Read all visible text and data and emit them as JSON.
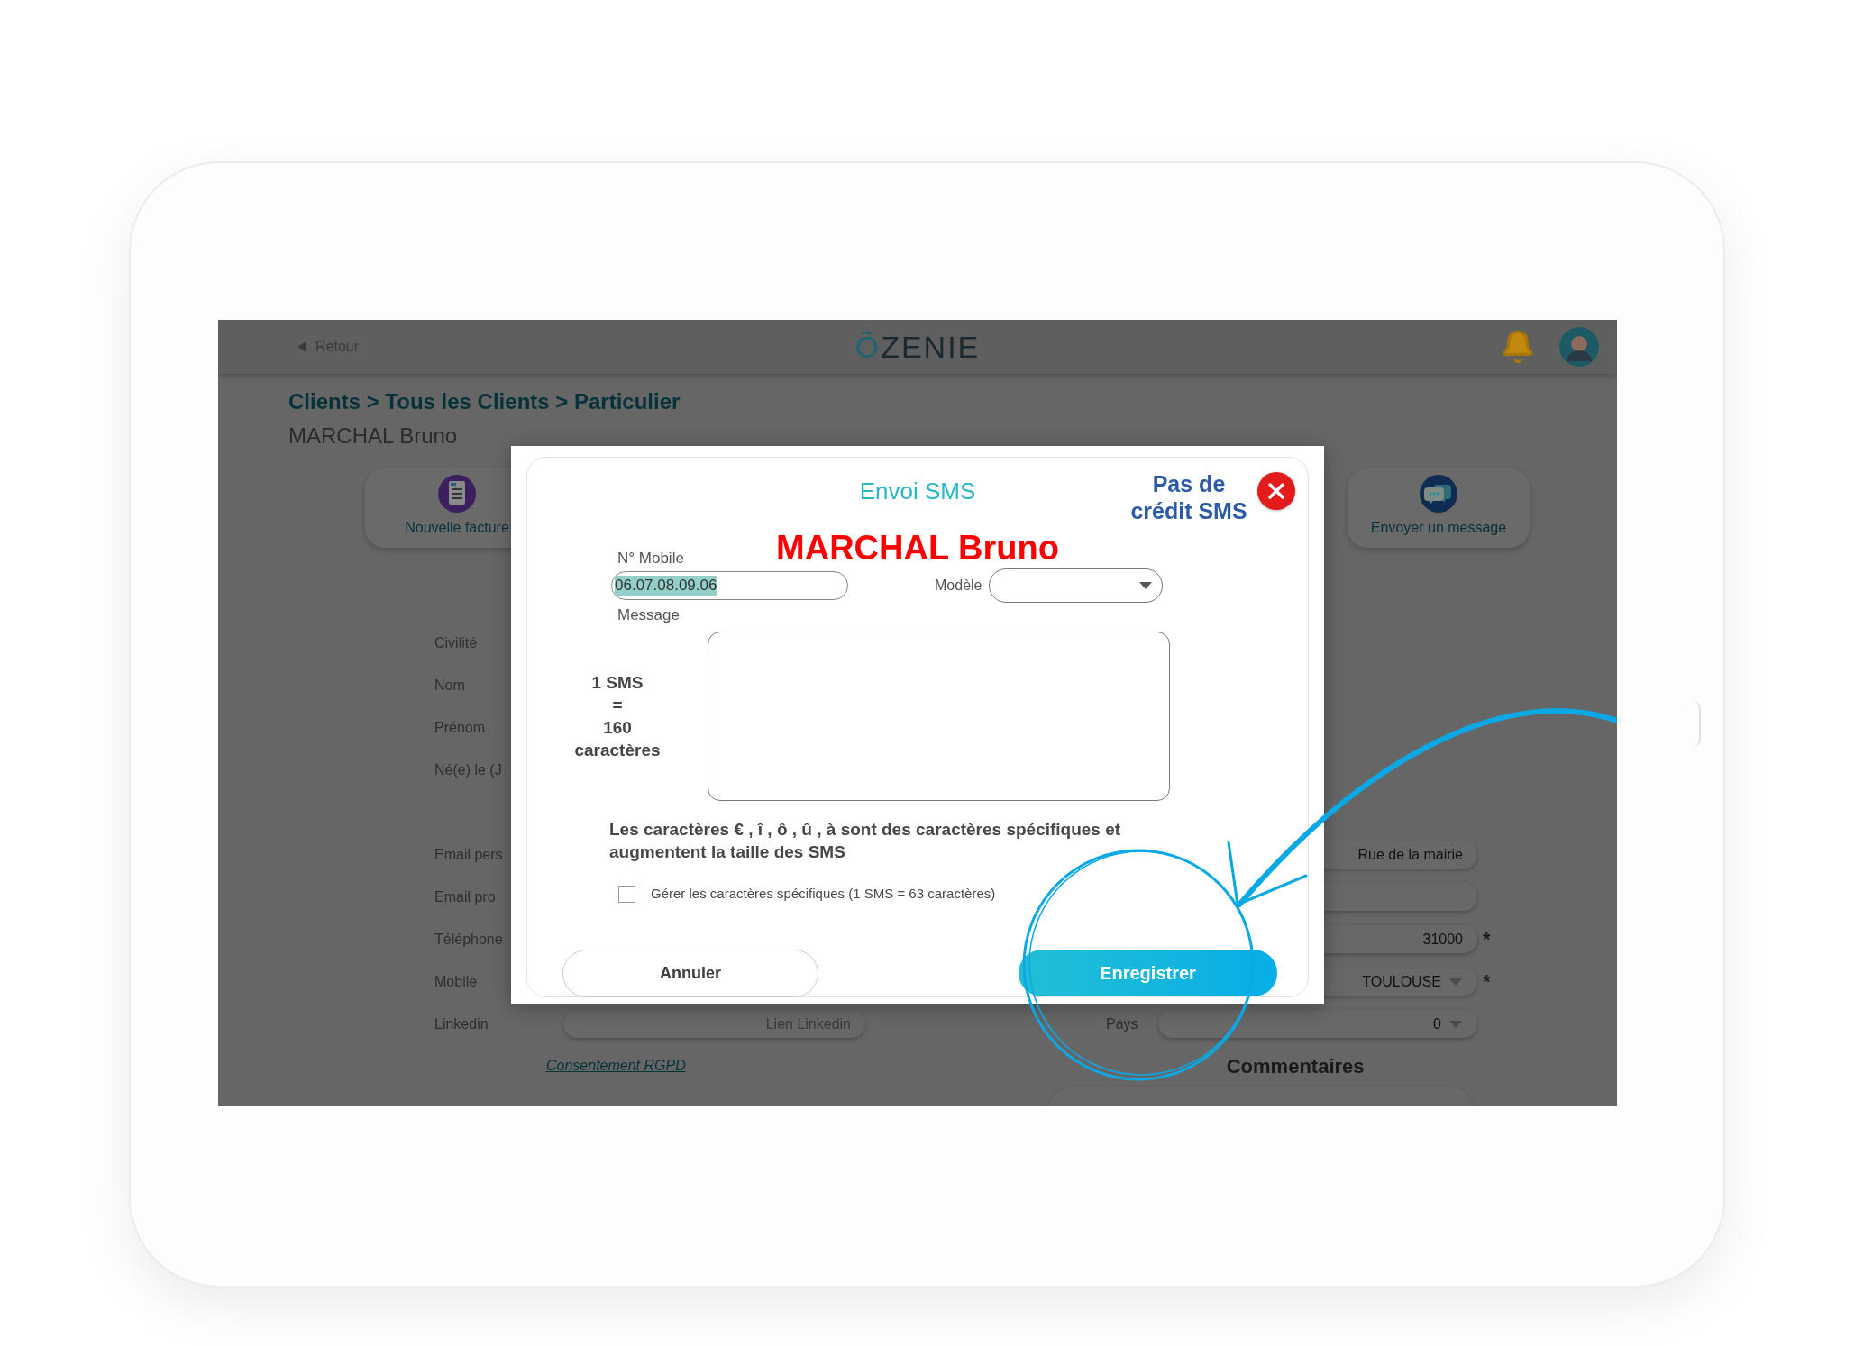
{
  "top_bar": {
    "back_label": "Retour",
    "logo": "ÕZENIE"
  },
  "breadcrumb": "Clients > Tous les Clients > Particulier",
  "client_name": "MARCHAL Bruno",
  "actions": [
    {
      "label": "Nouvelle facture",
      "kind": "invoice"
    },
    {
      "label": "Envoyer un message",
      "kind": "message"
    }
  ],
  "form": {
    "labels": [
      "Civilité",
      "Nom",
      "Prénom",
      "Né(e) le (J",
      "Email pers",
      "Email pro",
      "Téléphone",
      "Mobile",
      "Linkedin"
    ],
    "linkedin": {
      "placeholder": "Lien Linkedin"
    },
    "consent_link": "Consentement RGPD"
  },
  "address_fields": [
    {
      "kind": "text",
      "value": "Rue de la mairie"
    },
    {
      "kind": "text"
    },
    {
      "kind": "text",
      "value": "31000",
      "required_mark": "*"
    },
    {
      "kind": "dropdown",
      "value": "TOULOUSE",
      "required_mark": "*"
    }
  ],
  "country": {
    "label": "Pays",
    "value": "0"
  },
  "comments": {
    "heading": "Commentaires"
  },
  "sms_dialog": {
    "title": "Envoi SMS",
    "credit_notice": "Pas de crédit SMS",
    "recipient": "MARCHAL Bruno",
    "mobile": {
      "label": "N° Mobile",
      "value": "06.07.08.09.06",
      "selected": true
    },
    "template": {
      "label": "Modèle"
    },
    "message": {
      "label": "Message"
    },
    "sms_rule": [
      "1 SMS",
      "=",
      "160",
      "caractères"
    ],
    "note": "Les caractères € , î , ô , û , à sont des caractères spécifiques et augmentent la taille des SMS",
    "special_chars": {
      "label": "Gérer les caractères spécifiques (1 SMS = 63 caractères)",
      "checked": false
    },
    "buttons": [
      {
        "label": "Annuler",
        "kind": "secondary"
      },
      {
        "label": "Enregistrer",
        "kind": "primary"
      }
    ]
  }
}
